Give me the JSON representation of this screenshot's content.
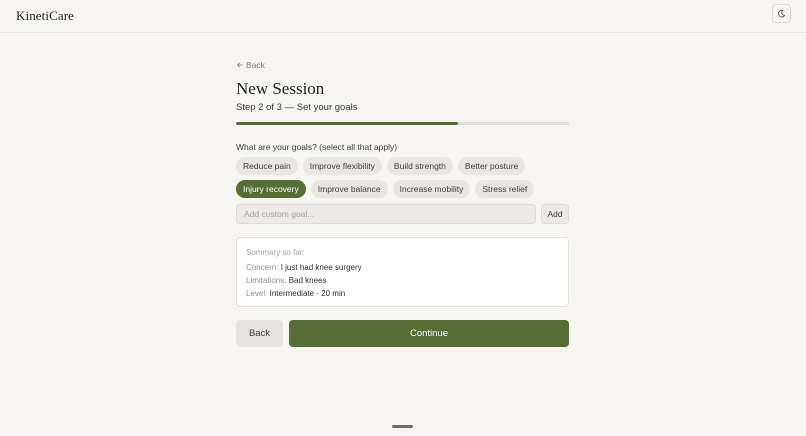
{
  "app": {
    "brand": "KinetiCare",
    "theme_icon": "moon-icon"
  },
  "nav": {
    "back_link": "Back",
    "back_icon": "arrow-left-icon"
  },
  "page": {
    "title": "New Session",
    "subtitle": "Step 2 of 3 — Set your goals",
    "progress": 0.667
  },
  "goals": {
    "question": "What are your goals? (select all that apply)",
    "row1": [
      {
        "label": "Reduce pain",
        "selected": false
      },
      {
        "label": "Improve flexibility",
        "selected": false
      },
      {
        "label": "Build strength",
        "selected": false
      },
      {
        "label": "Better posture",
        "selected": false
      }
    ],
    "row2": [
      {
        "label": "Injury recovery",
        "selected": true
      },
      {
        "label": "Improve balance",
        "selected": false
      },
      {
        "label": "Increase mobility",
        "selected": false
      },
      {
        "label": "Stress relief",
        "selected": false
      }
    ],
    "custom_placeholder": "Add custom goal...",
    "custom_value": "",
    "add_label": "Add"
  },
  "summary": {
    "heading": "Summary so far:",
    "concern_label": "Concern:",
    "concern_value": "I just had knee surgery",
    "limitations_label": "Limitations:",
    "limitations_value": "Bad knees",
    "level_label": "Level:",
    "level_value": "Intermediate · 20 min"
  },
  "actions": {
    "back_label": "Back",
    "continue_label": "Continue"
  },
  "colors": {
    "accent": "#566e36",
    "background": "#f6f5f2",
    "chip": "#e8e6e1"
  }
}
